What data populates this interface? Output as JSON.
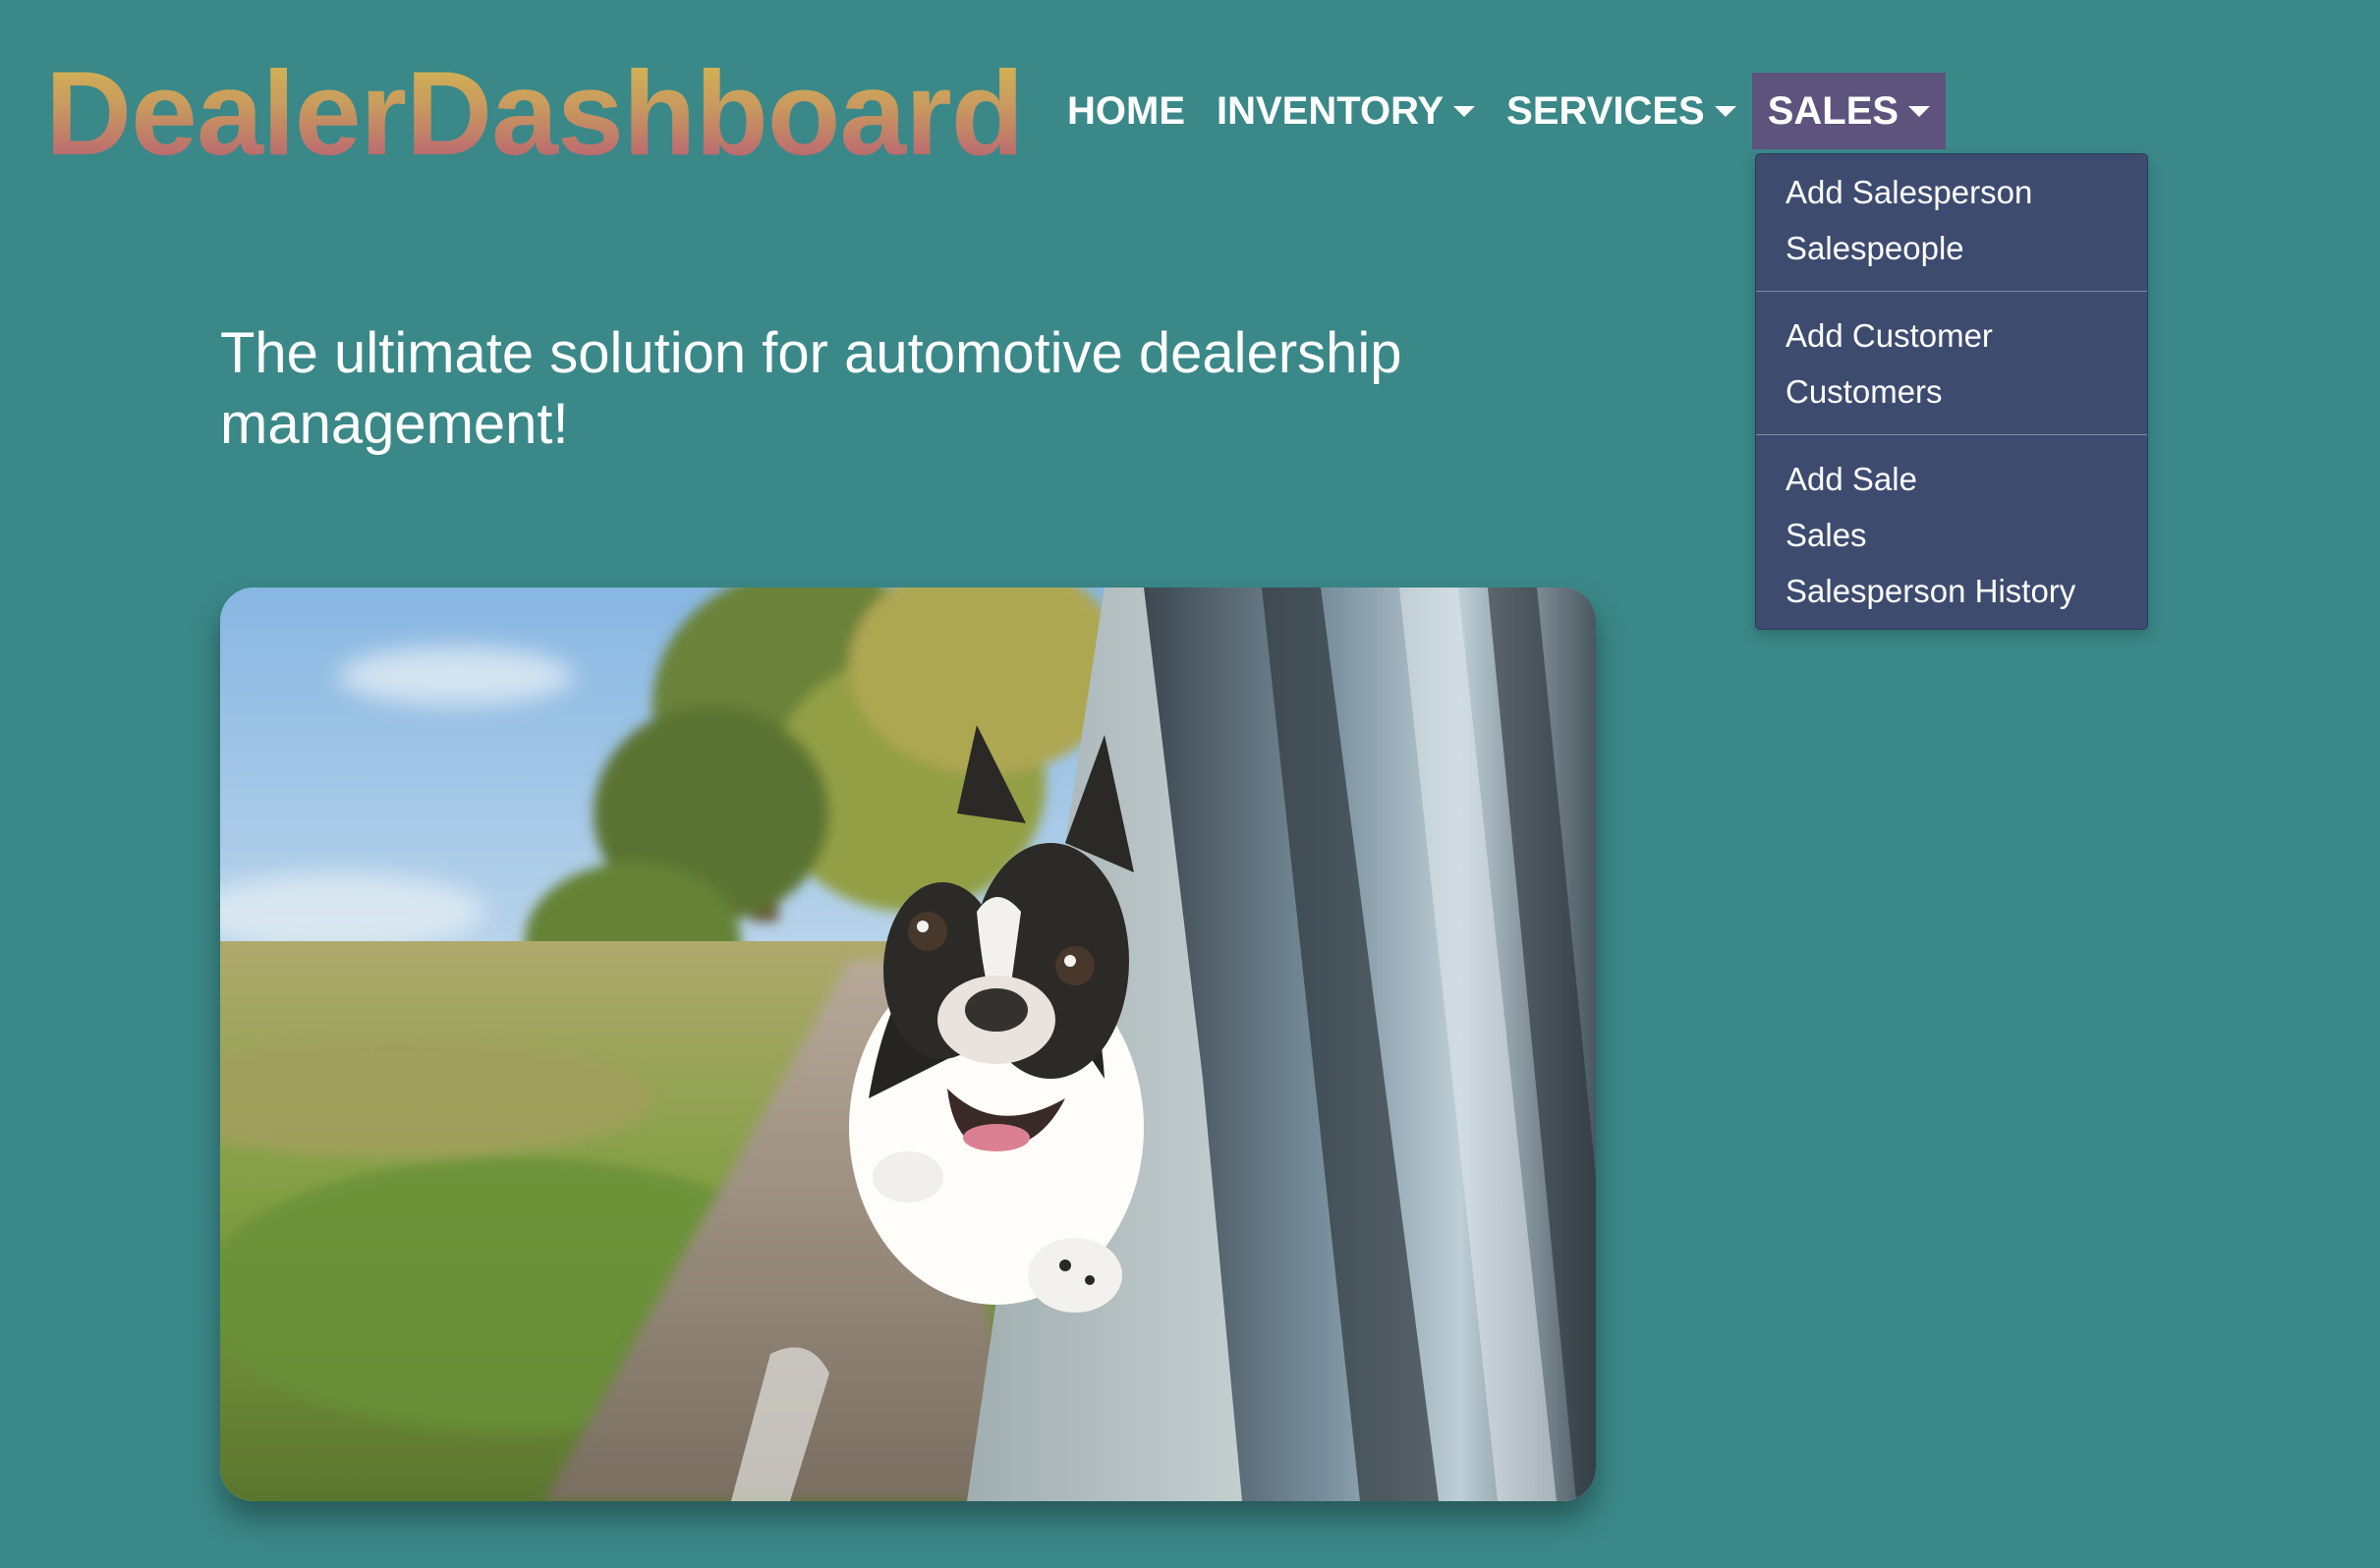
{
  "brand": {
    "name": "DealerDashboard"
  },
  "nav": {
    "items": [
      {
        "label": "HOME",
        "has_caret": false
      },
      {
        "label": "INVENTORY",
        "has_caret": true
      },
      {
        "label": "SERVICES",
        "has_caret": true
      },
      {
        "label": "SALES",
        "has_caret": true,
        "active": true
      }
    ]
  },
  "dropdown": {
    "groups": [
      [
        "Add Salesperson",
        "Salespeople"
      ],
      [
        "Add Customer",
        "Customers"
      ],
      [
        "Add Sale",
        "Sales",
        "Salesperson History"
      ]
    ]
  },
  "hero": {
    "tagline": "The ultimate solution for automotive dealership management!"
  },
  "colors": {
    "background": "#3b8888",
    "dropdown_bg": "#3d4b6f",
    "active_nav_bg": "#5d537c",
    "brand_gradient_top": "#d7c04f",
    "brand_gradient_bottom": "#b4507a"
  },
  "image": {
    "subject": "dog-looking-out-car-window"
  }
}
